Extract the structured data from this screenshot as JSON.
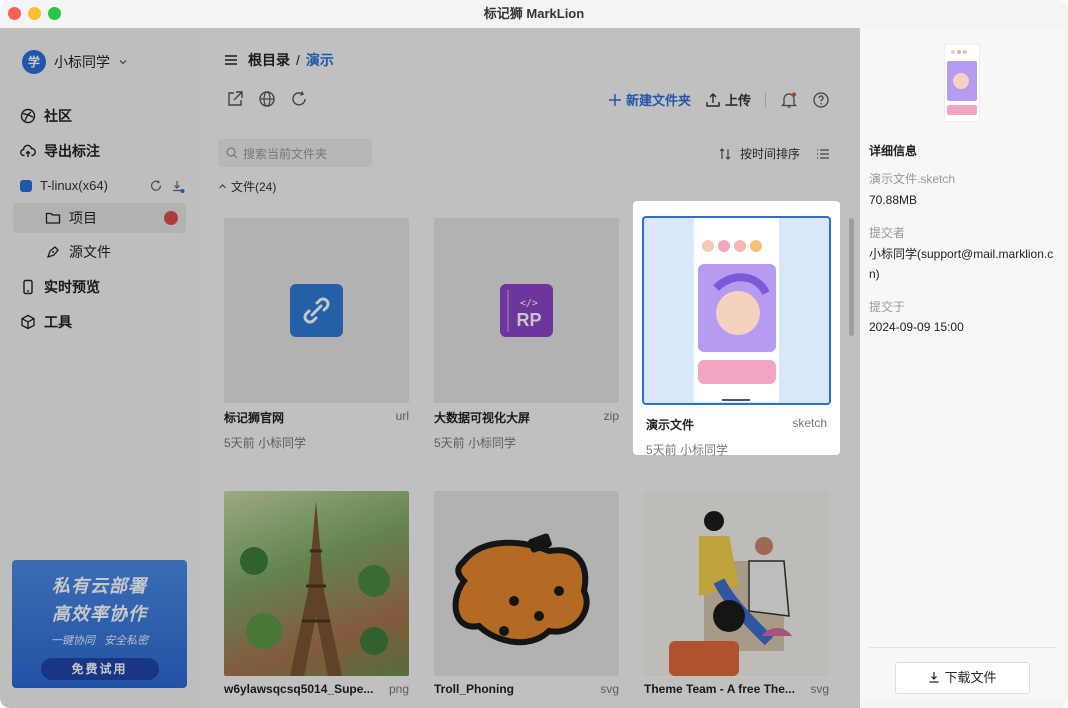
{
  "window": {
    "title": "标记狮 MarkLion"
  },
  "sidebar": {
    "user": {
      "avatar": "学",
      "name": "小标同学"
    },
    "nav": [
      {
        "label": "社区",
        "icon": "community-icon"
      },
      {
        "label": "导出标注",
        "icon": "cloud-upload-icon"
      }
    ],
    "team": {
      "name": "T-linux(x64)"
    },
    "sub_items": [
      {
        "label": "项目",
        "icon": "folder-icon"
      },
      {
        "label": "源文件",
        "icon": "pen-icon"
      }
    ],
    "nav2": [
      {
        "label": "实时预览",
        "icon": "phone-icon"
      },
      {
        "label": "工具",
        "icon": "cube-icon"
      }
    ],
    "promo": {
      "line1": "私有云部署",
      "line2": "高效率协作",
      "line3a": "一键协同",
      "line3b": "安全私密",
      "button": "免费试用"
    }
  },
  "main": {
    "breadcrumb": {
      "root": "根目录",
      "sep": "/",
      "current": "演示"
    },
    "toolbar": {
      "new_folder": "新建文件夹",
      "upload": "上传"
    },
    "search": {
      "placeholder": "搜索当前文件夹"
    },
    "sort": {
      "label": "按时间排序"
    },
    "section": {
      "label": "文件(24)"
    },
    "files": [
      {
        "name": "标记狮官网",
        "ext": "url",
        "meta": "5天前 小标同学",
        "icon": "link-icon",
        "color": "#2f7ad6"
      },
      {
        "name": "大数据可视化大屏",
        "ext": "zip",
        "meta": "5天前 小标同学",
        "icon": "rp-icon",
        "color": "#8e44c9"
      },
      {
        "name": "演示文件",
        "ext": "sketch",
        "meta": "5天前 小标同学",
        "icon": "phone-preview-icon"
      },
      {
        "name": "w6ylawsqcsq5014_Supe...",
        "ext": "png",
        "meta": "",
        "icon": "eiffel-image-icon"
      },
      {
        "name": "Troll_Phoning",
        "ext": "svg",
        "meta": "",
        "icon": "troll-image-icon"
      },
      {
        "name": "Theme Team - A free The...",
        "ext": "svg",
        "meta": "",
        "icon": "team-image-icon"
      }
    ]
  },
  "panel": {
    "title": "详细信息",
    "filename": "演示文件.sketch",
    "size": "70.88MB",
    "submitter_label": "提交者",
    "submitter": "小标同学(support@mail.marklion.cn)",
    "submitted_label": "提交于",
    "submitted": "2024-09-09 15:00",
    "download": "下载文件"
  }
}
